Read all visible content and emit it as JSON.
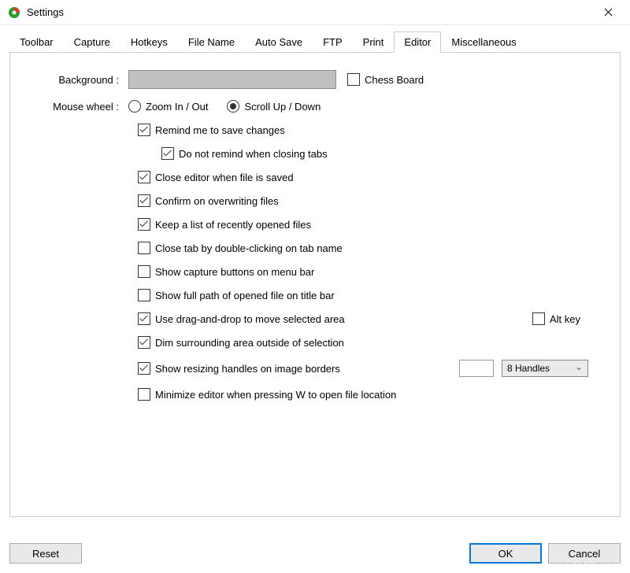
{
  "window": {
    "title": "Settings"
  },
  "tabs": [
    {
      "label": "Toolbar"
    },
    {
      "label": "Capture"
    },
    {
      "label": "Hotkeys"
    },
    {
      "label": "File Name"
    },
    {
      "label": "Auto Save"
    },
    {
      "label": "FTP"
    },
    {
      "label": "Print"
    },
    {
      "label": "Editor"
    },
    {
      "label": "Miscellaneous"
    }
  ],
  "active_tab": "Editor",
  "editor": {
    "background_label": "Background :",
    "chess_board": {
      "label": "Chess Board",
      "checked": false
    },
    "mousewheel_label": "Mouse wheel :",
    "mousewheel_options": {
      "zoom": "Zoom In / Out",
      "scroll": "Scroll Up / Down",
      "value": "scroll"
    },
    "remind_save": {
      "label": "Remind me to save changes",
      "checked": true
    },
    "no_remind_tabs": {
      "label": "Do not remind when closing tabs",
      "checked": true
    },
    "close_on_save": {
      "label": "Close editor when file is saved",
      "checked": true
    },
    "confirm_overwrite": {
      "label": "Confirm on overwriting files",
      "checked": true
    },
    "keep_recent": {
      "label": "Keep a list of recently opened files",
      "checked": true
    },
    "close_tab_dbl": {
      "label": "Close tab by double-clicking on tab name",
      "checked": false
    },
    "show_capture_buttons": {
      "label": "Show capture buttons on menu bar",
      "checked": false
    },
    "show_full_path": {
      "label": "Show full path of opened file on title bar",
      "checked": false
    },
    "drag_drop": {
      "label": "Use drag-and-drop to move selected area",
      "checked": true
    },
    "alt_key": {
      "label": "Alt key",
      "checked": false
    },
    "dim_surrounding": {
      "label": "Dim surrounding area outside of selection",
      "checked": true
    },
    "show_handles": {
      "label": "Show resizing handles on image borders",
      "checked": true
    },
    "handles_input": "",
    "handles_combo": "8 Handles",
    "minimize_w": {
      "label": "Minimize editor when pressing W to open file location",
      "checked": false
    }
  },
  "buttons": {
    "reset": "Reset",
    "ok": "OK",
    "cancel": "Cancel"
  },
  "watermark": "LO4D.com"
}
